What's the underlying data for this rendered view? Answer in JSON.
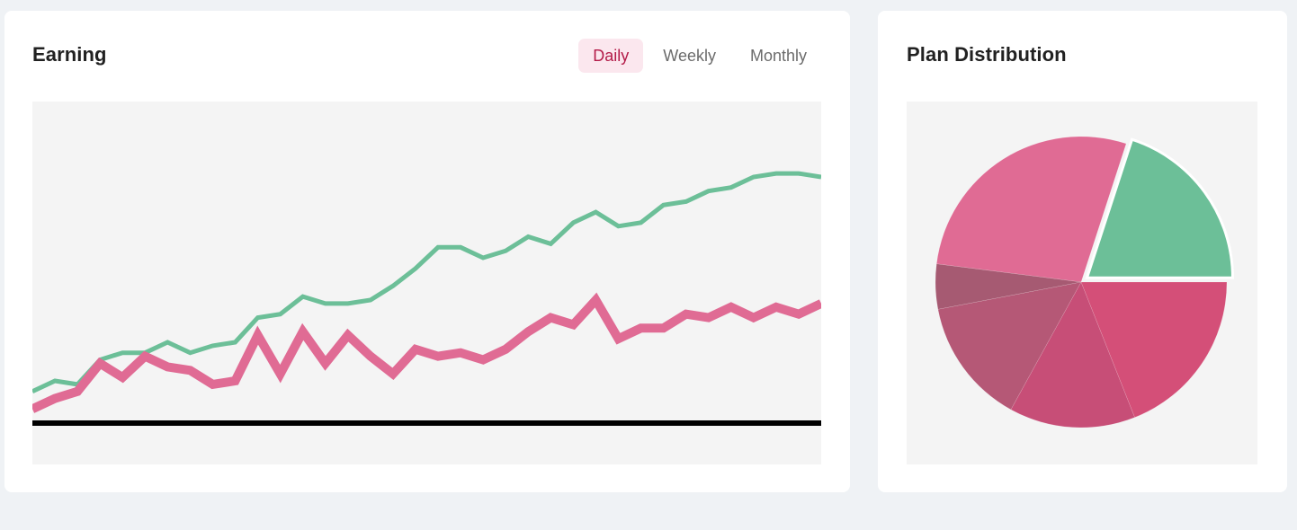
{
  "earning": {
    "title": "Earning",
    "tabs": [
      {
        "label": "Daily",
        "active": true
      },
      {
        "label": "Weekly",
        "active": false
      },
      {
        "label": "Monthly",
        "active": false
      }
    ]
  },
  "plan": {
    "title": "Plan Distribution"
  },
  "chart_data": [
    {
      "type": "line",
      "title": "",
      "xlabel": "",
      "ylabel": "",
      "x": [
        0,
        1,
        2,
        3,
        4,
        5,
        6,
        7,
        8,
        9,
        10,
        11,
        12,
        13,
        14,
        15,
        16,
        17,
        18,
        19,
        20,
        21,
        22,
        23,
        24,
        25,
        26,
        27,
        28,
        29,
        30,
        31,
        32,
        33,
        34,
        35
      ],
      "ylim": [
        0,
        100
      ],
      "baseline": 0,
      "grid": false,
      "series": [
        {
          "color": "#6cbf98",
          "values": [
            9,
            12,
            11,
            18,
            20,
            20,
            23,
            20,
            22,
            23,
            30,
            31,
            36,
            34,
            34,
            35,
            39,
            44,
            50,
            50,
            47,
            49,
            53,
            51,
            57,
            60,
            56,
            57,
            62,
            63,
            66,
            67,
            70,
            71,
            71,
            70
          ]
        },
        {
          "color": "#e06b94",
          "values": [
            4,
            7,
            9,
            17,
            13,
            19,
            16,
            15,
            11,
            12,
            25,
            14,
            26,
            17,
            25,
            19,
            14,
            21,
            19,
            20,
            18,
            21,
            26,
            30,
            28,
            35,
            24,
            27,
            27,
            31,
            30,
            33,
            30,
            33,
            31,
            34
          ]
        }
      ]
    },
    {
      "type": "pie",
      "title": "",
      "slices": [
        {
          "value": 20,
          "color": "#6cbf98",
          "exploded": true
        },
        {
          "value": 28,
          "color": "#e06b94"
        },
        {
          "value": 5,
          "color": "#a65a72"
        },
        {
          "value": 14,
          "color": "#b55876"
        },
        {
          "value": 14,
          "color": "#c74e77"
        },
        {
          "value": 19,
          "color": "#d44f78"
        }
      ]
    }
  ]
}
